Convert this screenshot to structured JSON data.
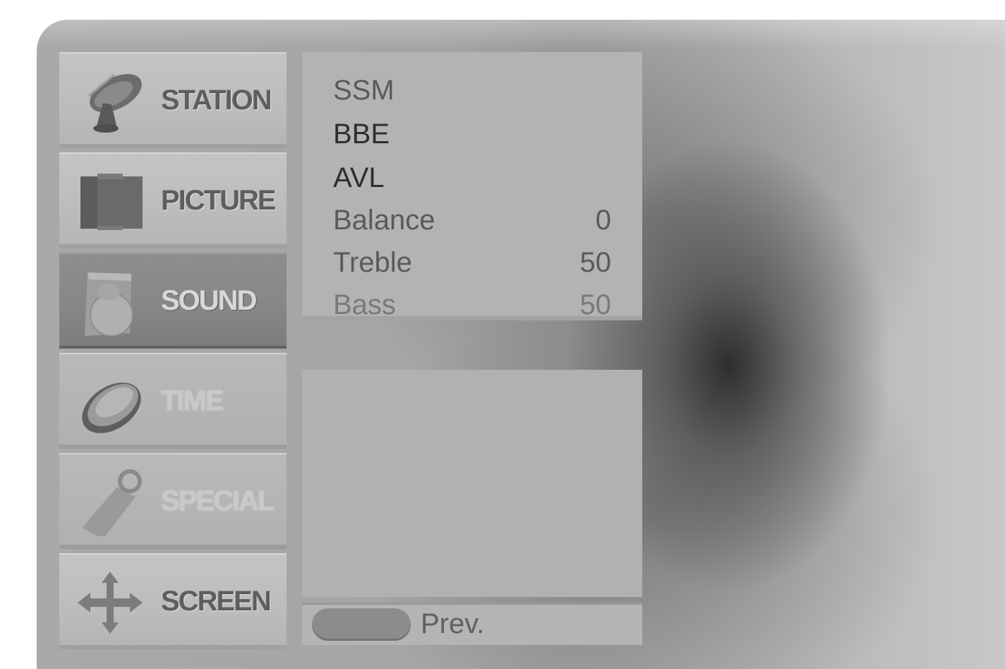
{
  "main_menu": {
    "items": [
      {
        "label": "STATION",
        "icon": "satellite-dish-icon",
        "state": "normal"
      },
      {
        "label": "PICTURE",
        "icon": "tv-screen-icon",
        "state": "normal"
      },
      {
        "label": "SOUND",
        "icon": "speaker-icon",
        "state": "selected"
      },
      {
        "label": "TIME",
        "icon": "clock-icon",
        "state": "disabled"
      },
      {
        "label": "SPECIAL",
        "icon": "tag-icon",
        "state": "disabled"
      },
      {
        "label": "SCREEN",
        "icon": "move-arrows-icon",
        "state": "normal"
      }
    ]
  },
  "sound_menu": {
    "items": [
      {
        "label": "SSM",
        "value": ""
      },
      {
        "label": "BBE",
        "value": ""
      },
      {
        "label": "AVL",
        "value": ""
      },
      {
        "label": "Balance",
        "value": "0"
      },
      {
        "label": "Treble",
        "value": "50"
      },
      {
        "label": "Bass",
        "value": "50"
      }
    ]
  },
  "nav": {
    "prev_label": "Prev."
  }
}
